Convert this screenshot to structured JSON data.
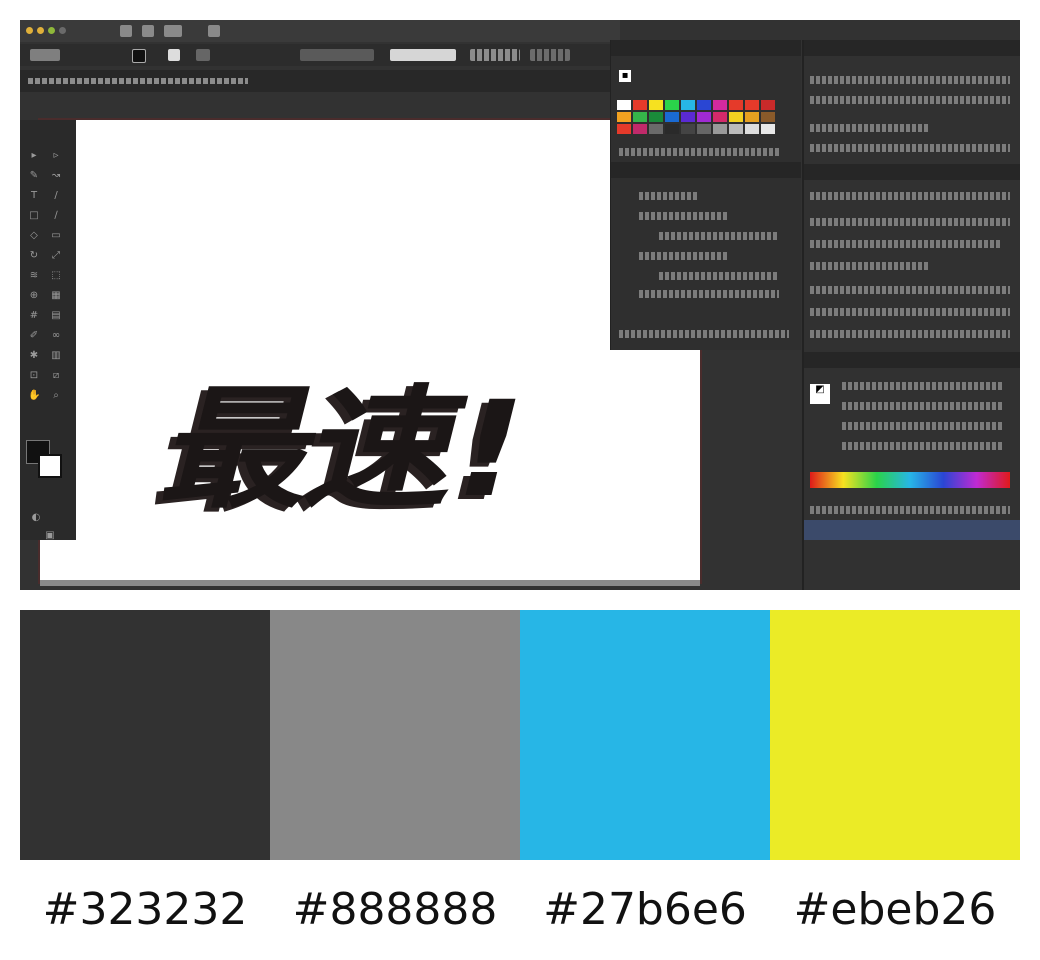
{
  "screenshot": {
    "logo_text": "最速!",
    "window_dot_colors": [
      "#e0b03a",
      "#e0b03a",
      "#8fb83a",
      "#6a6a6a"
    ],
    "accent_colors": {
      "panel_dark": "#323232",
      "artboard_border": "#4a2c2c",
      "layer_highlight": "#3b4a6a"
    },
    "icons": {
      "tools": "tool-icon",
      "fill_stroke": "fill-stroke-icon",
      "spectrum": "color-spectrum-icon"
    }
  },
  "palette": {
    "swatches": [
      {
        "hex": "#323232",
        "label": "#323232"
      },
      {
        "hex": "#888888",
        "label": "#888888"
      },
      {
        "hex": "#27b6e6",
        "label": "#27b6e6"
      },
      {
        "hex": "#ebeb26",
        "label": "#ebeb26"
      }
    ]
  }
}
